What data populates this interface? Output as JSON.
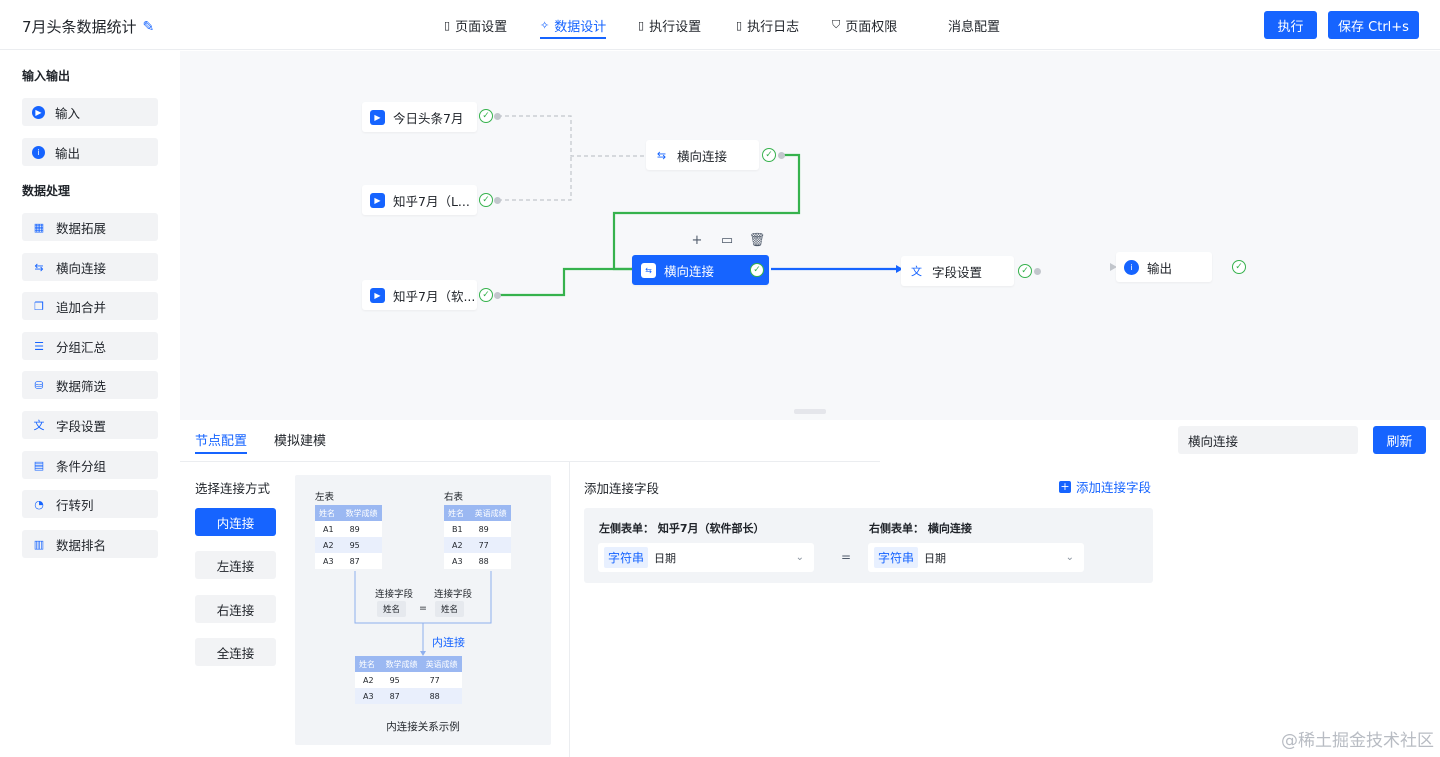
{
  "header": {
    "title": "7月头条数据统计",
    "tabs": [
      {
        "label": "页面设置",
        "icon": "bookmark-icon"
      },
      {
        "label": "数据设计",
        "icon": "data-design-icon",
        "active": true
      },
      {
        "label": "执行设置",
        "icon": "bookmark-icon"
      },
      {
        "label": "执行日志",
        "icon": "bookmark-icon"
      },
      {
        "label": "页面权限",
        "icon": "shield-icon"
      },
      {
        "label": "消息配置",
        "icon": ""
      }
    ],
    "execute_label": "执行",
    "save_label": "保存 Ctrl+s"
  },
  "sidebar": {
    "group1_title": "输入输出",
    "group1_items": [
      {
        "label": "输入",
        "icon": "play-icon"
      },
      {
        "label": "输出",
        "icon": "info-icon"
      }
    ],
    "group2_title": "数据处理",
    "group2_items": [
      {
        "label": "数据拓展",
        "icon": "grid-expand-icon"
      },
      {
        "label": "横向连接",
        "icon": "join-icon"
      },
      {
        "label": "追加合并",
        "icon": "append-icon"
      },
      {
        "label": "分组汇总",
        "icon": "group-summary-icon"
      },
      {
        "label": "数据筛选",
        "icon": "filter-icon"
      },
      {
        "label": "字段设置",
        "icon": "translate-icon"
      },
      {
        "label": "条件分组",
        "icon": "condition-group-icon"
      },
      {
        "label": "行转列",
        "icon": "row-to-column-icon"
      },
      {
        "label": "数据排名",
        "icon": "rank-icon"
      }
    ]
  },
  "canvas": {
    "nodes": [
      {
        "label": "今日头条7月",
        "icon": "play-icon",
        "status": "success"
      },
      {
        "label": "知乎7月（L...",
        "icon": "play-icon",
        "status": "success"
      },
      {
        "label": "知乎7月（软...",
        "icon": "play-icon",
        "status": "success"
      },
      {
        "label": "横向连接",
        "icon": "join-icon",
        "status": "success"
      },
      {
        "label": "横向连接",
        "icon": "join-icon",
        "status": "success",
        "selected": true
      },
      {
        "label": "字段设置",
        "icon": "translate-icon",
        "status": "success"
      },
      {
        "label": "输出",
        "icon": "info-icon",
        "status": "success"
      }
    ]
  },
  "panel": {
    "tabs": [
      "节点配置",
      "模拟建模"
    ],
    "node_name_value": "横向连接",
    "refresh_label": "刷新",
    "join_section_title": "选择连接方式",
    "join_types": [
      "内连接",
      "左连接",
      "右连接",
      "全连接"
    ],
    "active_join": "内连接",
    "diagram": {
      "left_title": "左表",
      "right_title": "右表",
      "left_headers": [
        "姓名",
        "数学成绩"
      ],
      "left_rows": [
        [
          "A1",
          "89"
        ],
        [
          "A2",
          "95"
        ],
        [
          "A3",
          "87"
        ]
      ],
      "right_headers": [
        "姓名",
        "英语成绩"
      ],
      "right_rows": [
        [
          "B1",
          "89"
        ],
        [
          "A2",
          "77"
        ],
        [
          "A3",
          "88"
        ]
      ],
      "join_field_label": "连接字段",
      "field_name": "姓名",
      "eq": "=",
      "join_label": "内连接",
      "result_headers": [
        "姓名",
        "数学成绩",
        "英语成绩"
      ],
      "result_rows": [
        [
          "A2",
          "95",
          "77"
        ],
        [
          "A3",
          "87",
          "88"
        ]
      ],
      "caption": "内连接关系示例"
    },
    "fields_title": "添加连接字段",
    "add_field_label": "添加连接字段",
    "left_form_label": "左侧表单：  知乎7月（软件部长）",
    "right_form_label": "右侧表单：  横向连接",
    "left_field": {
      "type": "字符串",
      "name": "日期"
    },
    "right_field": {
      "type": "字符串",
      "name": "日期"
    },
    "eq": "="
  },
  "watermark": "@稀土掘金技术社区",
  "colors": {
    "primary": "#1664ff",
    "success": "#36b24d",
    "canvas_bg": "#f7f8fa"
  }
}
